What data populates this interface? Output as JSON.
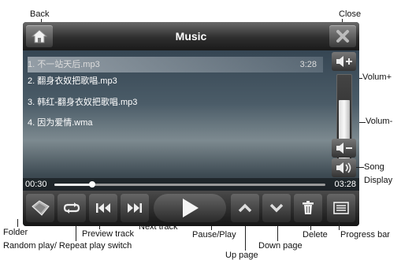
{
  "app": {
    "title": "Music"
  },
  "playlist": [
    {
      "label": "1. 不一站天后.mp3",
      "duration": "3:28",
      "selected": true
    },
    {
      "label": "2. 翻身衣奴把歌唱.mp3",
      "duration": ""
    },
    {
      "label": "3. 韩红-翻身衣奴把歌唱.mp3",
      "duration": ""
    },
    {
      "label": "4. 因为爱情.wma",
      "duration": ""
    }
  ],
  "playback": {
    "elapsed": "00:30",
    "total": "03:28",
    "progress": 0.14
  },
  "volume": {
    "level": 0.72
  },
  "annotations": {
    "back": "Back",
    "close": "Close",
    "volume_up": "Volum+",
    "volume_down": "Volum-",
    "song_display": "Song\nDisplay",
    "folder": "Folder",
    "random_repeat": "Random play/ Repeat play switch",
    "preview_track": "Preview  track",
    "next_track": "Next track",
    "pause_play": "Pause/Play",
    "up_page": "Up page",
    "down_page": "Down page",
    "delete": "Delete",
    "progress_bar": "Progress bar"
  },
  "icons": {
    "home": "home-icon",
    "close": "close-x-icon",
    "vol_up": "speaker-plus-icon",
    "vol_down": "speaker-minus-icon",
    "song_display": "speaker-wave-icon",
    "folder": "folder-icon",
    "repeat": "repeat-icon",
    "prev": "previous-track-icon",
    "next": "next-track-icon",
    "play": "play-icon",
    "up": "chevron-up-icon",
    "down": "chevron-down-icon",
    "delete": "trash-icon",
    "list": "list-icon"
  }
}
